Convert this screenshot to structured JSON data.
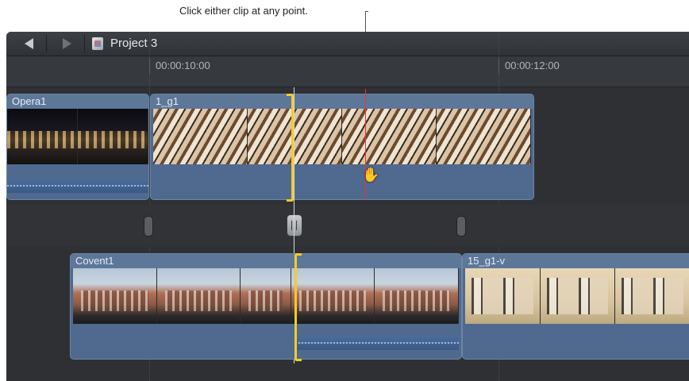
{
  "annotation": {
    "text": "Click either clip at any point."
  },
  "toolbar": {
    "back_icon": "back-arrow-icon",
    "forward_icon": "forward-arrow-icon",
    "project_title": "Project 3"
  },
  "ruler": {
    "marks": [
      "00:00:10:00",
      "00:00:12:00"
    ]
  },
  "clips": {
    "opera": {
      "name": "Opera1"
    },
    "g1": {
      "name": "1_g1"
    },
    "covent": {
      "name": "Covent1"
    },
    "g15": {
      "name": "15_g1-v"
    }
  },
  "colors": {
    "clip_blue": "#4f6a8e",
    "trim_yellow": "#f4cb2a",
    "playhead_red": "#e33333"
  }
}
